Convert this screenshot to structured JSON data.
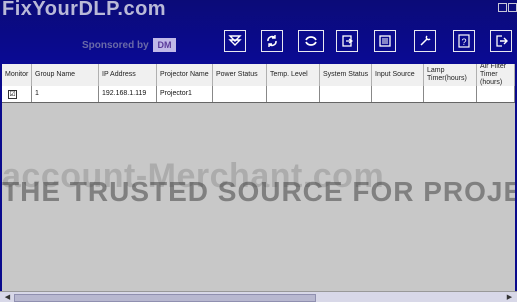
{
  "brand": {
    "watermark_text": "FixYourDLP.com",
    "sponsor_text": "Sponsored by",
    "sponsor_logo": "DM"
  },
  "toolbar": {
    "buttons": [
      {
        "name": "filter-icon"
      },
      {
        "name": "refresh-icon"
      },
      {
        "name": "sync-icon"
      },
      {
        "name": "input-icon"
      },
      {
        "name": "save-icon"
      },
      {
        "name": "tools-icon"
      },
      {
        "name": "help-icon"
      },
      {
        "name": "exit-icon"
      }
    ]
  },
  "table": {
    "headers": [
      "Monitor",
      "Group Name",
      "IP Address",
      "Projector Name",
      "Power Status",
      "Temp. Level",
      "System Status",
      "Input Source",
      "Lamp Timer(hours)",
      "Air Filter Timer (hours)"
    ],
    "rows": [
      {
        "monitor": "☑",
        "group": "1",
        "ip": "192.168.1.119",
        "name": "Projector1"
      }
    ]
  },
  "watermark": {
    "line1": "account-Merchant.com",
    "line2": "THE TRUSTED SOURCE FOR PROJECTOR"
  },
  "colors": {
    "titlebar": "#0a0a8c",
    "table_bg": "#c8c8c8"
  }
}
